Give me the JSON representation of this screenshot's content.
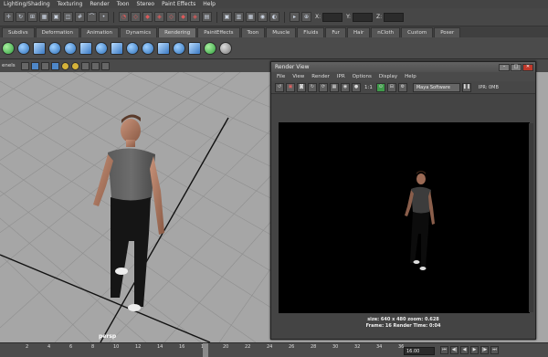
{
  "menubar": {
    "items": [
      "Lighting/Shading",
      "Texturing",
      "Render",
      "Toon",
      "Stereo",
      "Paint Effects",
      "Help"
    ]
  },
  "statusline": {
    "x_label": "X:",
    "y_label": "Y:",
    "z_label": "Z:"
  },
  "shelf_tabs": [
    "Subdivs",
    "Deformation",
    "Animation",
    "Dynamics",
    "Rendering",
    "PaintEffects",
    "Toon",
    "Muscle",
    "Fluids",
    "Fur",
    "Hair",
    "nCloth",
    "Custom",
    "Poser"
  ],
  "panel": {
    "menu_fragment": "enels"
  },
  "viewport": {
    "camera_label": "persp"
  },
  "render_view": {
    "title": "Render View",
    "menu": [
      "File",
      "View",
      "Render",
      "IPR",
      "Options",
      "Display",
      "Help"
    ],
    "ratio_label": "1:1",
    "renderer": "Maya Software",
    "ipr_label": "IPR: 0MB",
    "info_line1": "size: 640 x 480 zoom: 0.628",
    "info_line2": "Frame: 16      Render Time: 0:04"
  },
  "timeslider": {
    "ticks": [
      "2",
      "4",
      "6",
      "8",
      "10",
      "12",
      "14",
      "16",
      "18",
      "20",
      "22",
      "24",
      "26",
      "28",
      "30",
      "32",
      "34",
      "36"
    ],
    "current_frame": "16",
    "time_field": "16.00"
  }
}
